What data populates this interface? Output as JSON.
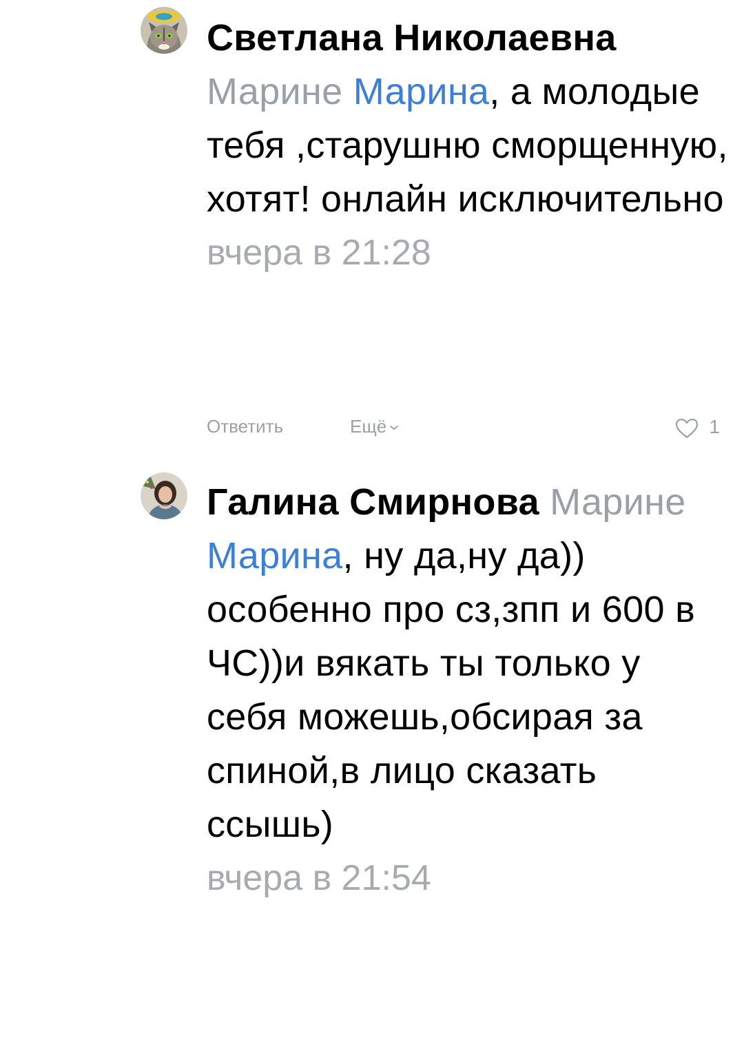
{
  "comments": [
    {
      "author": "Светлана Николаевна",
      "reply_to": "Марине",
      "mention": "Марина",
      "text": ", а молодые тебя ,старушню сморщенную, хотят! онлайн исключительно",
      "timestamp": "вчера в 21:28",
      "reply_label": "Ответить",
      "more_label": "Ещё",
      "likes": "1"
    },
    {
      "author": "Галина Смирнова",
      "reply_to": "Марине",
      "mention": "Марина",
      "text": ", ну да,ну да)) особенно про сз,зпп и 600 в ЧС))и вякать ты только у себя можешь,обсирая за спиной,в лицо сказать ссышь)",
      "timestamp": "вчера в 21:54"
    }
  ],
  "colors": {
    "mention": "#3d7fd6",
    "muted": "#9aa0a6",
    "text": "#000000"
  },
  "icons": {
    "more": "chevron-down-icon",
    "like": "heart-outline-icon"
  }
}
